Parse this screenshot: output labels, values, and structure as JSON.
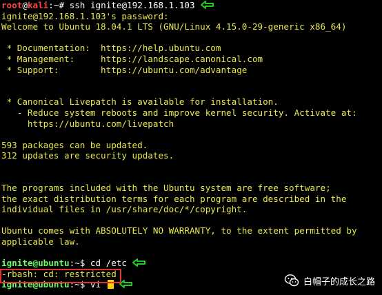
{
  "terminal": {
    "line1": {
      "user": "root",
      "at": "@",
      "host": "kali",
      "sep": ":~# ",
      "cmd": "ssh ignite@192.168.1.103"
    },
    "password_prompt": "ignite@192.168.1.103's password:",
    "welcome": "Welcome to Ubuntu 18.04.1 LTS (GNU/Linux 4.15.0-29-generic x86_64)",
    "doc": " * Documentation:  https://help.ubuntu.com",
    "mgmt": " * Management:     https://landscape.canonical.com",
    "support": " * Support:        https://ubuntu.com/advantage",
    "livepatch1": " * Canonical Livepatch is available for installation.",
    "livepatch2": "   - Reduce system reboots and improve kernel security. Activate at:",
    "livepatch3": "     https://ubuntu.com/livepatch",
    "packages": "593 packages can be updated.",
    "security": "312 updates are security updates.",
    "free1": "The programs included with the Ubuntu system are free software;",
    "free2": "the exact distribution terms for each program are described in the",
    "free3": "individual files in /usr/share/doc/*/copyright.",
    "warranty1": "Ubuntu comes with ABSOLUTELY NO WARRANTY, to the extent permitted by",
    "warranty2": "applicable law.",
    "cd_line": {
      "userhost": "ignite@ubuntu",
      "sep": ":~$ ",
      "cmd": "cd /etc"
    },
    "rbash": "-rbash: cd: restricted",
    "vi_line": {
      "userhost": "ignite@ubuntu",
      "sep": ":~$ ",
      "cmd": "vi "
    }
  },
  "watermark": {
    "text": "白帽子的成长之路",
    "icon": "wechat-icon"
  },
  "colors": {
    "arrow": "#22cc22",
    "highlight_box": "#e03030",
    "text": "#e8e84c"
  }
}
